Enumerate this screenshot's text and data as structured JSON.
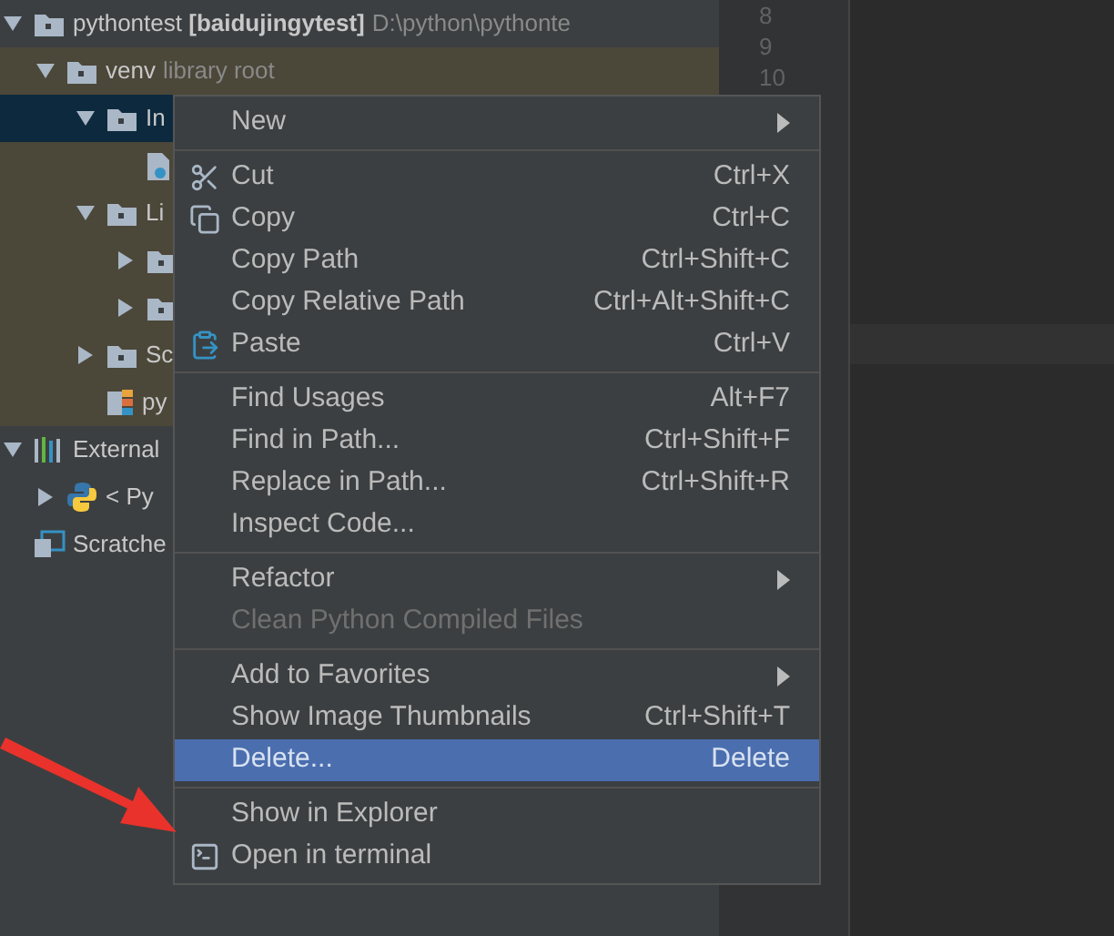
{
  "project_tree": [
    {
      "label": "pythontest **[baidujingytest]**",
      "note": "D:\\python\\pythonte",
      "kind": "folder",
      "expanded": true,
      "selected": false,
      "children": [
        {
          "label": "venv",
          "note": "library root",
          "kind": "folder",
          "expanded": true,
          "selected": false,
          "children": [
            {
              "label": "In",
              "kind": "folder",
              "expanded": true,
              "selected": true,
              "children": [
                {
                  "kind": "file",
                  "selected": false
                }
              ]
            },
            {
              "label": "Li",
              "kind": "folder",
              "expanded": true,
              "selected": false,
              "children": [
                {
                  "kind": "folder",
                  "expanded": false,
                  "selected": false
                },
                {
                  "kind": "folder",
                  "expanded": false,
                  "selected": false
                }
              ]
            },
            {
              "label": "Sc",
              "kind": "folder",
              "expanded": false,
              "selected": false
            },
            {
              "label": "py",
              "kind": "config",
              "selected": false
            }
          ]
        }
      ]
    },
    {
      "label": "External",
      "kind": "library",
      "expanded": true,
      "selected": false,
      "children": [
        {
          "label": "< Py",
          "kind": "python",
          "expanded": false,
          "selected": false
        }
      ]
    },
    {
      "label": "Scratche",
      "kind": "scratch",
      "selected": false
    }
  ],
  "line_numbers": [
    "8",
    "9",
    "10"
  ],
  "context_menu": [
    [
      {
        "label": "New",
        "submenu": true,
        "disabled": false,
        "selected": false
      }
    ],
    [
      {
        "label": "Cut",
        "shortcut": "Ctrl+X",
        "submenu": false,
        "disabled": false,
        "selected": false
      },
      {
        "label": "Copy",
        "shortcut": "Ctrl+C",
        "submenu": false,
        "disabled": false,
        "selected": false
      },
      {
        "label": "Copy Path",
        "shortcut": "Ctrl+Shift+C",
        "submenu": false,
        "disabled": false,
        "selected": false
      },
      {
        "label": "Copy Relative Path",
        "shortcut": "Ctrl+Alt+Shift+C",
        "submenu": false,
        "disabled": false,
        "selected": false
      },
      {
        "label": "Paste",
        "shortcut": "Ctrl+V",
        "submenu": false,
        "disabled": false,
        "selected": false
      }
    ],
    [
      {
        "label": "Find Usages",
        "shortcut": "Alt+F7",
        "submenu": false,
        "disabled": false,
        "selected": false
      },
      {
        "label": "Find in Path...",
        "shortcut": "Ctrl+Shift+F",
        "submenu": false,
        "disabled": false,
        "selected": false
      },
      {
        "label": "Replace in Path...",
        "shortcut": "Ctrl+Shift+R",
        "submenu": false,
        "disabled": false,
        "selected": false
      },
      {
        "label": "Inspect Code...",
        "submenu": false,
        "disabled": false,
        "selected": false
      }
    ],
    [
      {
        "label": "Refactor",
        "submenu": true,
        "disabled": false,
        "selected": false
      },
      {
        "label": "Clean Python Compiled Files",
        "submenu": false,
        "disabled": true,
        "selected": false
      }
    ],
    [
      {
        "label": "Add to Favorites",
        "submenu": true,
        "disabled": false,
        "selected": false
      },
      {
        "label": "Show Image Thumbnails",
        "shortcut": "Ctrl+Shift+T",
        "submenu": false,
        "disabled": false,
        "selected": false
      },
      {
        "label": "Delete...",
        "shortcut": "Delete",
        "submenu": false,
        "disabled": false,
        "selected": true
      }
    ],
    [
      {
        "label": "Show in Explorer",
        "submenu": false,
        "disabled": false,
        "selected": false
      },
      {
        "label": "Open in terminal",
        "submenu": false,
        "disabled": false,
        "selected": false
      }
    ]
  ]
}
